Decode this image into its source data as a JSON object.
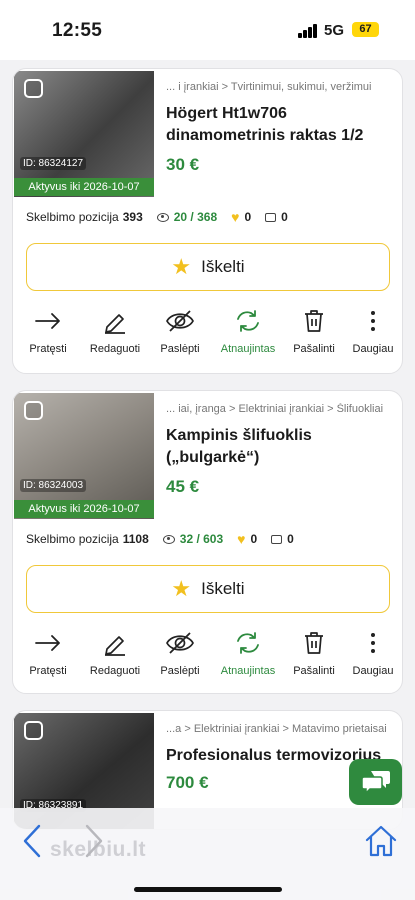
{
  "status": {
    "time": "12:55",
    "network": "5G",
    "battery": "67"
  },
  "listings": [
    {
      "breadcrumb": "...  i įrankiai > Tvirtinimui, sukimui, veržimui",
      "title": "Högert Ht1w706 dinamometrinis raktas 1/2",
      "price": "30 €",
      "ad_id": "ID: 86324127",
      "active_until": "Aktyvus iki 2026-10-07",
      "position_label": "Skelbimo pozicija",
      "position": "393",
      "views": "20 / 368",
      "likes": "0",
      "messages": "0",
      "boost_label": "Iškelti"
    },
    {
      "breadcrumb": "... iai, įranga > Elektriniai įrankiai > Šlifuokliai",
      "title": "Kampinis šlifuoklis („bulgarkė“)",
      "price": "45 €",
      "ad_id": "ID: 86324003",
      "active_until": "Aktyvus iki 2026-10-07",
      "position_label": "Skelbimo pozicija",
      "position": "1108",
      "views": "32 / 603",
      "likes": "0",
      "messages": "0",
      "boost_label": "Iškelti"
    },
    {
      "breadcrumb": "...a > Elektriniai įrankiai > Matavimo prietaisai",
      "title": "Profesionalus termovizorius",
      "price": "700 €",
      "ad_id": "ID: 86323891"
    }
  ],
  "actions": {
    "extend": "Pratęsti",
    "edit": "Redaguoti",
    "hide": "Paslėpti",
    "renewed": "Atnaujintas",
    "delete": "Pašalinti",
    "more": "Daugiau"
  },
  "browser": {
    "brand": "skelbiu.lt"
  },
  "colors": {
    "accent_green": "#2d8a3e",
    "star_yellow": "#f2c01f",
    "active_bar": "#3a8f3a"
  }
}
